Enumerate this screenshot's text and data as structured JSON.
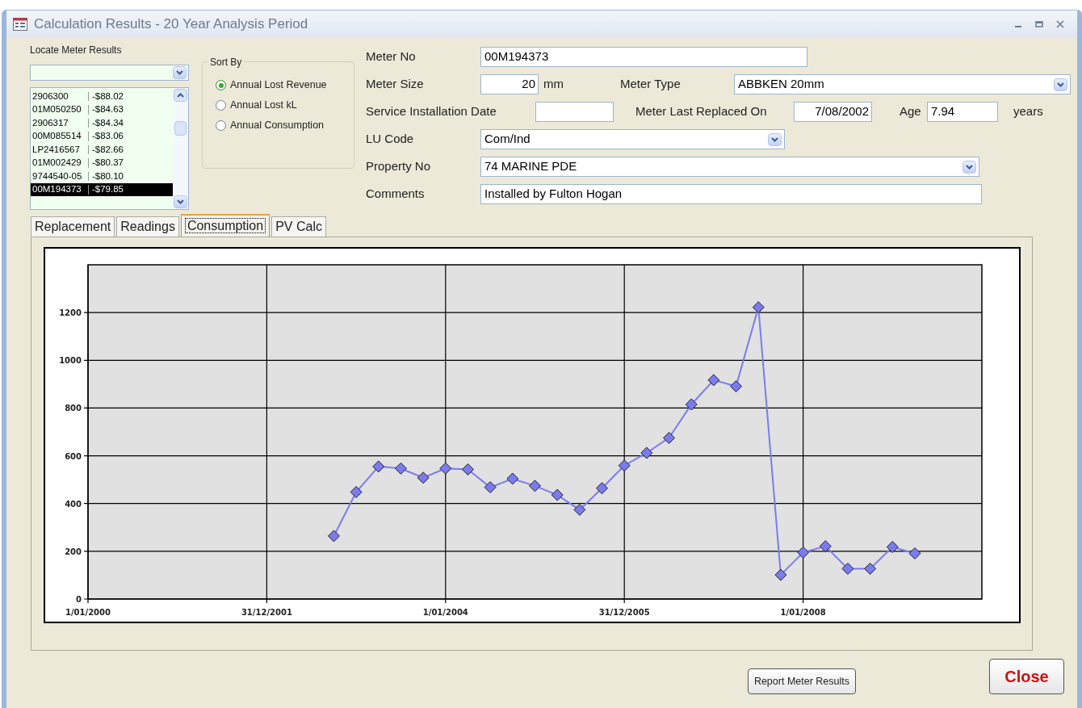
{
  "window": {
    "title": "Calculation Results - 20 Year Analysis Period"
  },
  "locate": {
    "label": "Locate Meter Results",
    "rows": [
      {
        "meter": "2906300",
        "value": "-$88.02",
        "selected": false
      },
      {
        "meter": "01M050250",
        "value": "-$84.63",
        "selected": false
      },
      {
        "meter": "2906317",
        "value": "-$84.34",
        "selected": false
      },
      {
        "meter": "00M085514",
        "value": "-$83.06",
        "selected": false
      },
      {
        "meter": "LP2416567",
        "value": "-$82.66",
        "selected": false
      },
      {
        "meter": "01M002429",
        "value": "-$80.37",
        "selected": false
      },
      {
        "meter": "9744540-05",
        "value": "-$80.10",
        "selected": false
      },
      {
        "meter": "00M194373",
        "value": "-$79.85",
        "selected": true
      }
    ]
  },
  "sort_by": {
    "title": "Sort By",
    "options": [
      {
        "label": "Annual Lost Revenue",
        "selected": true
      },
      {
        "label": "Annual Lost kL",
        "selected": false
      },
      {
        "label": "Annual Consumption",
        "selected": false
      }
    ]
  },
  "form": {
    "meter_no": {
      "label": "Meter No",
      "value": "00M194373"
    },
    "meter_size": {
      "label": "Meter Size",
      "value": "20",
      "unit": "mm"
    },
    "meter_type": {
      "label": "Meter Type",
      "value": "ABBKEN 20mm"
    },
    "service_installation_date": {
      "label": "Service Installation Date"
    },
    "meter_last_replaced_on": {
      "label": "Meter Last Replaced On",
      "value": "7/08/2002"
    },
    "age": {
      "label": "Age",
      "value": "7.94",
      "unit": "years"
    },
    "lu_code": {
      "label": "LU Code",
      "value": "Com/Ind"
    },
    "property_no": {
      "label": "Property No",
      "value": "74 MARINE PDE"
    },
    "comments": {
      "label": "Comments",
      "value": "Installed by Fulton Hogan"
    }
  },
  "tabs": [
    {
      "label": "Replacement",
      "selected": false
    },
    {
      "label": "Readings",
      "selected": false
    },
    {
      "label": "Consumption",
      "selected": true
    },
    {
      "label": "PV Calc",
      "selected": false
    }
  ],
  "chart_data": {
    "type": "line",
    "grid": true,
    "ylim": [
      0,
      1400
    ],
    "categories": [
      "1/01/2000",
      null,
      null,
      null,
      null,
      null,
      null,
      null,
      "31/12/2001",
      null,
      null,
      null,
      null,
      null,
      null,
      null,
      "1/01/2004",
      null,
      null,
      null,
      null,
      null,
      null,
      null,
      "31/12/2005",
      null,
      null,
      null,
      null,
      null,
      null,
      null,
      "1/01/2008",
      null,
      null,
      null,
      null,
      null,
      null,
      null
    ],
    "yticks": [
      0,
      200,
      400,
      600,
      800,
      1000,
      1200
    ],
    "series": [
      {
        "color": "#7b7bf0",
        "marker": "diamond",
        "values": [
          null,
          null,
          null,
          null,
          null,
          null,
          null,
          null,
          null,
          null,
          null,
          264,
          448,
          555,
          547,
          508,
          547,
          543,
          468,
          504,
          474,
          436,
          374,
          464,
          559,
          612,
          675,
          815,
          917,
          891,
          1222,
          101,
          195,
          221,
          127,
          127,
          218,
          191,
          null,
          null
        ]
      }
    ]
  },
  "buttons": {
    "report": "Report Meter Results",
    "close": "Close"
  }
}
